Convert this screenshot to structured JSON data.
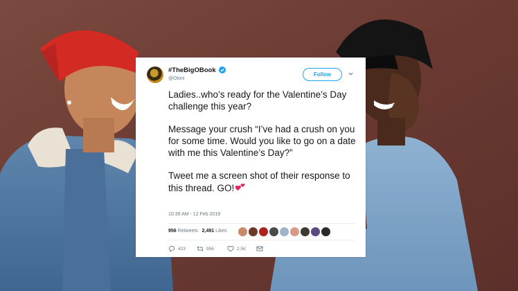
{
  "tweet": {
    "display_name": "#TheBigOBook",
    "handle": "@Oloni",
    "follow_label": "Follow",
    "body": [
      "Ladies..who’s ready for the Valentine’s Day challenge this year?",
      "Message your crush “I’ve had a crush on you for some time. Would you like to go on a date with me this Valentine’s Day?”",
      "Tweet me a screen shot of their response to this thread. GO!"
    ],
    "timestamp": "10:39 AM - 12 Feb 2019",
    "retweets_count": "956",
    "retweets_label": "Retweets",
    "likes_count": "2,491",
    "likes_label": "Likes",
    "reply_count": "423",
    "retweet_action_count": "956",
    "like_action_count": "2.5K"
  },
  "icons": [
    "verified-icon",
    "chevron-down-icon",
    "two-hearts-emoji",
    "reply-icon",
    "retweet-icon",
    "like-icon",
    "message-icon"
  ],
  "colors": {
    "accent": "#1da1f2",
    "text": "#14171a",
    "muted": "#657786",
    "divider": "#e6ecf0",
    "background": "#6e3e35"
  }
}
